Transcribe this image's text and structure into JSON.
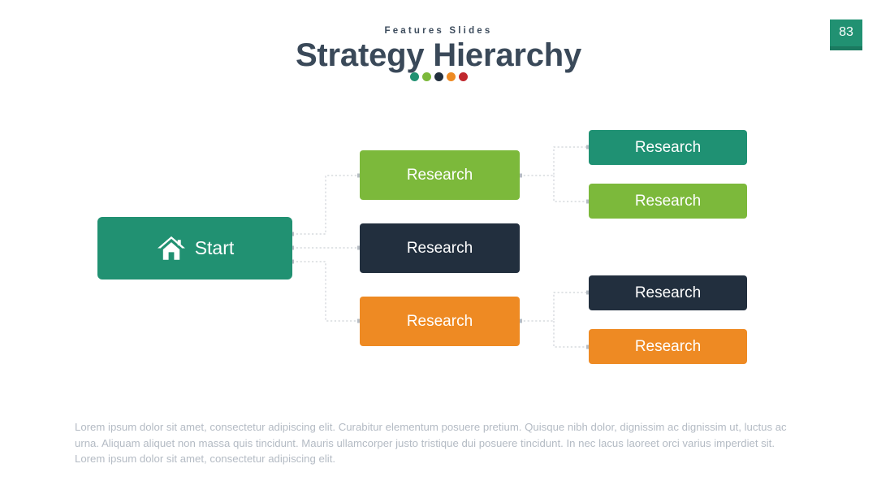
{
  "header": {
    "eyebrow": "Features Slides",
    "title": "Strategy Hierarchy",
    "accent_dots": [
      {
        "name": "dot-teal",
        "color": "#219172"
      },
      {
        "name": "dot-green",
        "color": "#7cb93b"
      },
      {
        "name": "dot-navy",
        "color": "#222f3e"
      },
      {
        "name": "dot-orange",
        "color": "#ee8a23"
      },
      {
        "name": "dot-red",
        "color": "#c0272d"
      }
    ]
  },
  "page_badge": {
    "number": "83",
    "color": "#219172",
    "underline_color": "#1b7a60"
  },
  "diagram": {
    "root": {
      "label": "Start",
      "icon": "home-icon",
      "color": "#219172"
    },
    "level_two": [
      {
        "label": "Research",
        "color": "#7cb93b"
      },
      {
        "label": "Research",
        "color": "#222f3e"
      },
      {
        "label": "Research",
        "color": "#ee8a23"
      }
    ],
    "level_three": [
      {
        "label": "Research",
        "color": "#1f9173"
      },
      {
        "label": "Research",
        "color": "#7cb93b"
      },
      {
        "label": "Research",
        "color": "#222f3e"
      },
      {
        "label": "Research",
        "color": "#ee8a23"
      }
    ],
    "connector_color": "#cfd3d8"
  },
  "footer": {
    "paragraph": "Lorem ipsum dolor sit amet, consectetur adipiscing elit. Curabitur elementum posuere pretium. Quisque nibh dolor, dignissim ac dignissim ut, luctus ac urna. Aliquam aliquet non massa quis tincidunt. Mauris ullamcorper justo tristique dui posuere tincidunt. In nec lacus laoreet orci varius imperdiet sit. Lorem ipsum dolor sit amet, consectetur adipiscing elit."
  }
}
